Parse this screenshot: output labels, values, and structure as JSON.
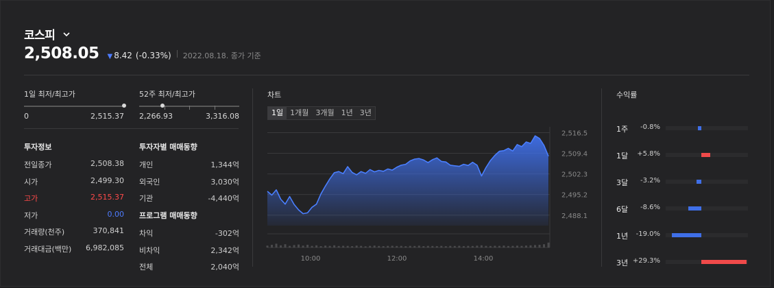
{
  "header": {
    "title": "코스피",
    "price": "2,508.05",
    "change": "8.42",
    "change_pct": "(-0.33%)",
    "date_note": "2022.08.18. 종가 기준",
    "down_color": "#4d7cff"
  },
  "ranges": [
    {
      "label": "1일 최저/최고가",
      "low": "0",
      "high": "2,515.37",
      "position": 1.0
    },
    {
      "label": "52주 최저/최고가",
      "low": "2,266.93",
      "high": "3,316.08",
      "position": 0.23
    }
  ],
  "invest_info": {
    "title": "투자정보",
    "rows": [
      {
        "label": "전일종가",
        "value": "2,508.38",
        "color": ""
      },
      {
        "label": "시가",
        "value": "2,499.30",
        "color": ""
      },
      {
        "label": "고가",
        "value": "2,515.37",
        "color": "red"
      },
      {
        "label": "저가",
        "value": "0.00",
        "color": "blue"
      },
      {
        "label": "거래량(천주)",
        "value": "370,841",
        "color": ""
      },
      {
        "label": "거래대금(백만)",
        "value": "6,982,085",
        "color": ""
      }
    ]
  },
  "investor_trading": {
    "title": "투자자별 매매동향",
    "rows": [
      {
        "label": "개인",
        "value": "1,344억"
      },
      {
        "label": "외국인",
        "value": "3,030억"
      },
      {
        "label": "기관",
        "value": "-4,440억"
      }
    ]
  },
  "program_trading": {
    "title": "프로그램 매매동향",
    "rows": [
      {
        "label": "차익",
        "value": "-302억"
      },
      {
        "label": "비차익",
        "value": "2,342억"
      },
      {
        "label": "전체",
        "value": "2,040억"
      }
    ]
  },
  "chart": {
    "title": "차트",
    "tabs": [
      "1일",
      "1개월",
      "3개월",
      "1년",
      "3년"
    ],
    "active_tab": "1일"
  },
  "chart_data": {
    "type": "area",
    "x_ticks": [
      "10:00",
      "12:00",
      "14:00"
    ],
    "y_ticks": [
      "2,516.5",
      "2,509.4",
      "2,502.3",
      "2,495.2",
      "2,488.1"
    ],
    "ylim": [
      2484.5,
      2518.5
    ],
    "series": [
      {
        "values": [
          2496.3,
          2495.0,
          2496.8,
          2493.6,
          2491.9,
          2494.5,
          2491.8,
          2489.9,
          2488.6,
          2488.9,
          2490.8,
          2491.9,
          2495.4,
          2498.1,
          2500.6,
          2502.7,
          2503.1,
          2502.4,
          2504.8,
          2502.8,
          2502.0,
          2503.1,
          2502.5,
          2503.8,
          2503.0,
          2503.5,
          2503.2,
          2504.0,
          2503.6,
          2504.6,
          2505.3,
          2505.6,
          2506.8,
          2507.4,
          2507.6,
          2507.1,
          2506.2,
          2507.2,
          2507.8,
          2506.6,
          2506.4,
          2505.3,
          2505.1,
          2504.9,
          2505.6,
          2505.2,
          2506.3,
          2505.3,
          2501.6,
          2504.5,
          2506.9,
          2508.7,
          2510.1,
          2510.3,
          2511.1,
          2510.2,
          2512.4,
          2511.7,
          2513.3,
          2512.8,
          2515.4,
          2514.5,
          2512.1,
          2508.4
        ]
      }
    ],
    "volume": [
      0.35,
      0.5,
      0.7,
      0.4,
      0.6,
      0.3,
      0.45,
      0.55,
      0.35,
      0.5,
      0.3,
      0.4,
      0.25,
      0.35,
      0.3,
      0.4,
      0.28,
      0.32,
      0.3,
      0.25,
      0.35,
      0.3,
      0.22,
      0.3,
      0.35,
      0.28,
      0.25,
      0.3,
      0.32,
      0.28,
      0.3,
      0.24,
      0.3,
      0.28,
      0.34,
      0.25,
      0.3,
      0.28,
      0.26,
      0.3,
      0.24,
      0.3,
      0.28,
      0.32,
      0.26,
      0.3,
      0.28,
      0.34,
      0.4,
      0.3,
      0.28,
      0.32,
      0.3,
      0.35,
      0.28,
      0.3,
      0.34,
      0.3,
      0.36,
      0.4,
      0.45,
      0.5,
      0.6,
      0.9
    ],
    "line_color": "#4a7fff",
    "grid": true
  },
  "returns": {
    "title": "수익률",
    "rows": [
      {
        "period": "1주",
        "value": "-0.8%",
        "num": -0.8
      },
      {
        "period": "1달",
        "value": "+5.8%",
        "num": 5.8
      },
      {
        "period": "3달",
        "value": "-3.2%",
        "num": -3.2
      },
      {
        "period": "6달",
        "value": "-8.6%",
        "num": -8.6
      },
      {
        "period": "1년",
        "value": "-19.0%",
        "num": -19.0
      },
      {
        "period": "3년",
        "value": "+29.3%",
        "num": 29.3
      }
    ],
    "pos_color": "#f04a4a",
    "neg_color": "#3f6fe8"
  }
}
